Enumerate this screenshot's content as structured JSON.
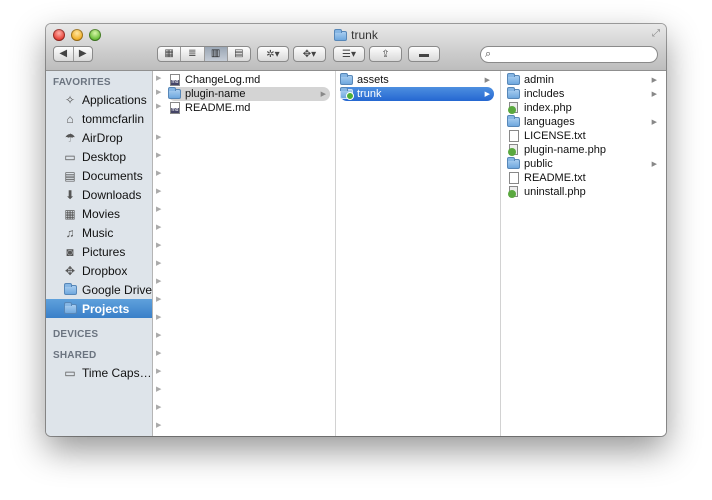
{
  "window": {
    "title": "trunk"
  },
  "search": {
    "placeholder": ""
  },
  "sidebar": {
    "favorites_header": "FAVORITES",
    "favorites": [
      {
        "label": "Applications",
        "icon": "applications-icon"
      },
      {
        "label": "tommcfarlin",
        "icon": "home-icon"
      },
      {
        "label": "AirDrop",
        "icon": "airdrop-icon"
      },
      {
        "label": "Desktop",
        "icon": "desktop-icon"
      },
      {
        "label": "Documents",
        "icon": "documents-icon"
      },
      {
        "label": "Downloads",
        "icon": "downloads-icon"
      },
      {
        "label": "Movies",
        "icon": "movies-icon"
      },
      {
        "label": "Music",
        "icon": "music-icon"
      },
      {
        "label": "Pictures",
        "icon": "pictures-icon"
      },
      {
        "label": "Dropbox",
        "icon": "dropbox-icon"
      },
      {
        "label": "Google Drive",
        "icon": "folder-icon"
      },
      {
        "label": "Projects",
        "icon": "folder-icon",
        "selected": true
      }
    ],
    "devices_header": "DEVICES",
    "shared_header": "SHARED",
    "shared": [
      {
        "label": "Time Caps…",
        "icon": "drive-icon"
      }
    ]
  },
  "columns": [
    {
      "items": [
        {
          "label": "ChangeLog.md",
          "kind": "md"
        },
        {
          "label": "plugin-name",
          "kind": "folder",
          "selected": "gray",
          "expandable": true
        },
        {
          "label": "README.md",
          "kind": "md"
        }
      ]
    },
    {
      "items": [
        {
          "label": "assets",
          "kind": "folder",
          "expandable": true
        },
        {
          "label": "trunk",
          "kind": "folder",
          "badge": true,
          "selected": "blue",
          "expandable": true
        }
      ]
    },
    {
      "items": [
        {
          "label": "admin",
          "kind": "folder",
          "expandable": true
        },
        {
          "label": "includes",
          "kind": "folder",
          "expandable": true
        },
        {
          "label": "index.php",
          "kind": "php"
        },
        {
          "label": "languages",
          "kind": "folder",
          "expandable": true
        },
        {
          "label": "LICENSE.txt",
          "kind": "txt"
        },
        {
          "label": "plugin-name.php",
          "kind": "php"
        },
        {
          "label": "public",
          "kind": "folder",
          "expandable": true
        },
        {
          "label": "README.txt",
          "kind": "txt"
        },
        {
          "label": "uninstall.php",
          "kind": "php"
        }
      ]
    }
  ],
  "colors": {
    "selection_blue": "#2f74d0",
    "sidebar_bg": "#dee4ea",
    "sidebar_selected": "#3a7fc8"
  }
}
